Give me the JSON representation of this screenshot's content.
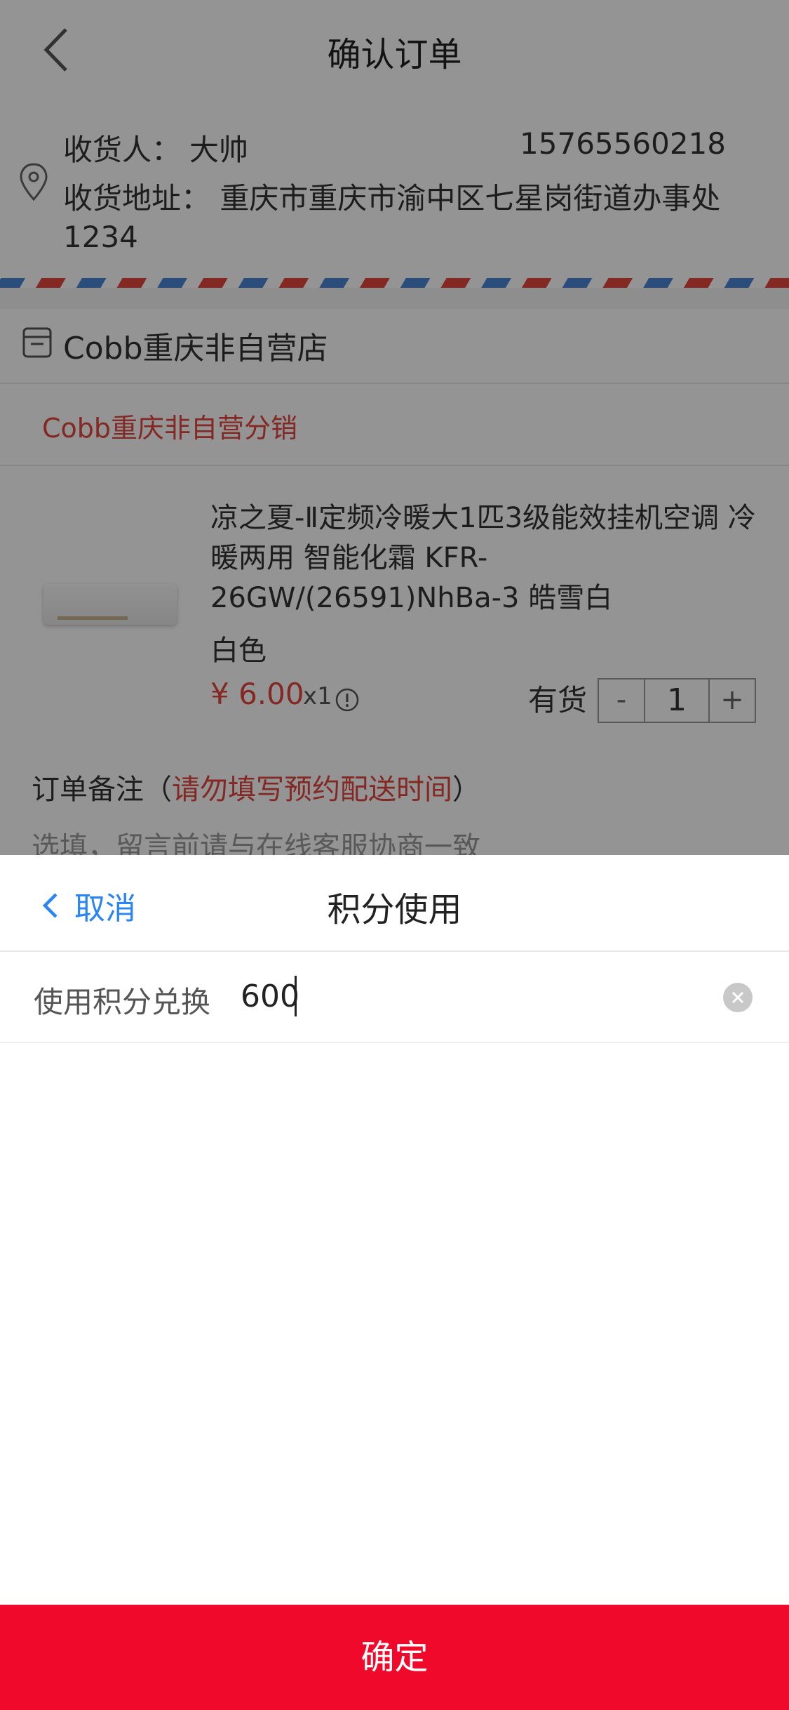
{
  "page": {
    "nav_title": "确认订单"
  },
  "address": {
    "receiver_label": "收货人：",
    "receiver_name": "大帅",
    "phone": "15765560218",
    "address_label": "收货地址：",
    "address_value": "重庆市重庆市渝中区七星岗街道办事处1234"
  },
  "store": {
    "name": "Cobb重庆非自营店",
    "distribution": "Cobb重庆非自营分销"
  },
  "product": {
    "title": "凉之夏-Ⅱ定频冷暖大1匹3级能效挂机空调 冷暖两用 智能化霜 KFR-26GW/(26591)NhBa-3 皓雪白",
    "spec": "白色",
    "price": "¥ 6.00",
    "quantity_mul": "x1",
    "stock": "有货",
    "quantity": "1",
    "minus": "-",
    "plus": "+"
  },
  "note": {
    "label_prefix": "订单备注（",
    "label_hint": "请勿填写预约配送时间",
    "label_suffix": "）",
    "placeholder": "选填，留言前请与在线客服协商一致"
  },
  "sheet": {
    "cancel_label": "取消",
    "title": "积分使用",
    "field_label": "使用积分兑换",
    "field_value": "600",
    "confirm_label": "确定"
  },
  "colors": {
    "accent_blue": "#2a84f6",
    "confirm_red": "#f0092a",
    "price_red": "#e3453d"
  }
}
